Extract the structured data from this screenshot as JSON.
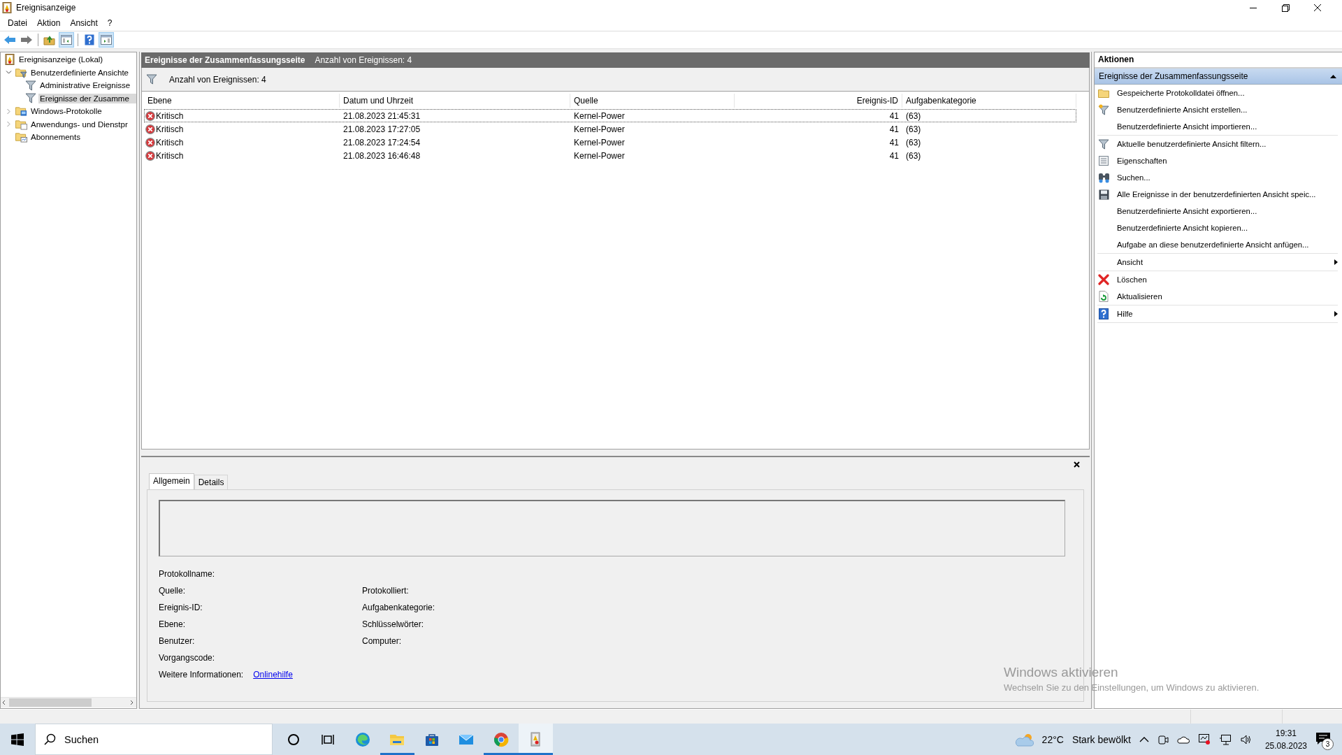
{
  "window": {
    "title": "Ereignisanzeige"
  },
  "menu": [
    {
      "label": "Datei"
    },
    {
      "label": "Aktion"
    },
    {
      "label": "Ansicht"
    },
    {
      "label": "?"
    }
  ],
  "toolbar": [
    {
      "kind": "back",
      "pressed": false
    },
    {
      "kind": "forward",
      "pressed": false
    },
    {
      "kind": "sep"
    },
    {
      "kind": "up",
      "pressed": false
    },
    {
      "kind": "tree-pane",
      "pressed": true
    },
    {
      "kind": "sep"
    },
    {
      "kind": "help",
      "pressed": false
    },
    {
      "kind": "action-pane",
      "pressed": true
    }
  ],
  "tree": [
    {
      "label": "Ereignisanzeige (Lokal)",
      "kind": "log",
      "selected": false,
      "children": [
        {
          "label": "Benutzerdefinierte Ansichte",
          "kind": "folder-filter",
          "selected": false,
          "expanded": true,
          "children": [
            {
              "label": "Administrative Ereignisse",
              "kind": "filter",
              "selected": false
            },
            {
              "label": "Ereignisse der Zusamme",
              "kind": "filter",
              "selected": true
            }
          ]
        },
        {
          "label": "Windows-Protokolle",
          "kind": "folder-log",
          "selected": false,
          "expanded": false
        },
        {
          "label": "Anwendungs- und Dienstpr",
          "kind": "folder",
          "selected": false,
          "expanded": false
        },
        {
          "label": "Abonnements",
          "kind": "folder-sub",
          "selected": false
        }
      ]
    }
  ],
  "summary_header": {
    "title": "Ereignisse der Zusammenfassungsseite",
    "count": "Anzahl von Ereignissen: 4"
  },
  "filter_bar": {
    "text": "Anzahl von Ereignissen: 4"
  },
  "table": {
    "columns": [
      "Ebene",
      "Datum und Uhrzeit",
      "Quelle",
      "Ereignis-ID",
      "Aufgabenkategorie"
    ],
    "rows": [
      {
        "level": "Kritisch",
        "date": "21.08.2023 21:45:31",
        "source": "Kernel-Power",
        "id": "41",
        "category": "(63)",
        "focused": true
      },
      {
        "level": "Kritisch",
        "date": "21.08.2023 17:27:05",
        "source": "Kernel-Power",
        "id": "41",
        "category": "(63)",
        "focused": false
      },
      {
        "level": "Kritisch",
        "date": "21.08.2023 17:24:54",
        "source": "Kernel-Power",
        "id": "41",
        "category": "(63)",
        "focused": false
      },
      {
        "level": "Kritisch",
        "date": "21.08.2023 16:46:48",
        "source": "Kernel-Power",
        "id": "41",
        "category": "(63)",
        "focused": false
      }
    ]
  },
  "detail": {
    "tabs": [
      {
        "label": "Allgemein",
        "selected": true
      },
      {
        "label": "Details",
        "selected": false
      }
    ],
    "fields": [
      {
        "left": "Protokollname:"
      },
      {
        "left": "Quelle:",
        "right": "Protokolliert:"
      },
      {
        "left": "Ereignis-ID:",
        "right": "Aufgabenkategorie:"
      },
      {
        "left": "Ebene:",
        "right": "Schlüsselwörter:"
      },
      {
        "left": "Benutzer:",
        "right": "Computer:"
      },
      {
        "left": "Vorgangscode:"
      }
    ],
    "more_info": {
      "label": "Weitere Informationen:",
      "link": "Onlinehilfe"
    }
  },
  "actions": {
    "title": "Aktionen",
    "section": "Ereignisse der Zusammenfassungsseite",
    "groups": [
      [
        {
          "label": "Gespeicherte Protokolldatei öffnen...",
          "kind": "open"
        },
        {
          "label": "Benutzerdefinierte Ansicht erstellen...",
          "kind": "create"
        },
        {
          "label": "Benutzerdefinierte Ansicht importieren...",
          "kind": "plain"
        }
      ],
      [
        {
          "label": "Aktuelle benutzerdefinierte Ansicht filtern...",
          "kind": "filter"
        },
        {
          "label": "Eigenschaften",
          "kind": "properties"
        },
        {
          "label": "Suchen...",
          "kind": "find"
        },
        {
          "label": "Alle Ereignisse in der benutzerdefinierten Ansicht speic...",
          "kind": "save"
        },
        {
          "label": "Benutzerdefinierte Ansicht exportieren...",
          "kind": "plain"
        },
        {
          "label": "Benutzerdefinierte Ansicht kopieren...",
          "kind": "plain"
        },
        {
          "label": "Aufgabe an diese benutzerdefinierte Ansicht anfügen...",
          "kind": "plain"
        }
      ],
      [
        {
          "label": "Ansicht",
          "kind": "plain",
          "submenu": true
        }
      ],
      [
        {
          "label": "Löschen",
          "kind": "delete"
        },
        {
          "label": "Aktualisieren",
          "kind": "refresh"
        }
      ],
      [
        {
          "label": "Hilfe",
          "kind": "help",
          "submenu": true
        }
      ]
    ]
  },
  "activation": {
    "title": "Windows aktivieren",
    "text": "Wechseln Sie zu den Einstellungen, um Windows zu aktivieren."
  },
  "taskbar": {
    "search": {
      "placeholder": "Suchen"
    },
    "apps": [
      {
        "kind": "cortana",
        "running": false,
        "active": false
      },
      {
        "kind": "taskview",
        "running": false,
        "active": false
      },
      {
        "kind": "edge",
        "running": false,
        "active": false
      },
      {
        "kind": "explorer",
        "running": true,
        "active": false
      },
      {
        "kind": "store",
        "running": false,
        "active": false
      },
      {
        "kind": "mail",
        "running": false,
        "active": false
      },
      {
        "kind": "chrome",
        "running": true,
        "active": false
      },
      {
        "kind": "eventviewer",
        "running": true,
        "active": true
      }
    ],
    "weather": {
      "temperature": "22°C",
      "condition": "Stark bewölkt"
    },
    "time": "19:31",
    "date": "25.08.2023",
    "notifications": "3"
  }
}
